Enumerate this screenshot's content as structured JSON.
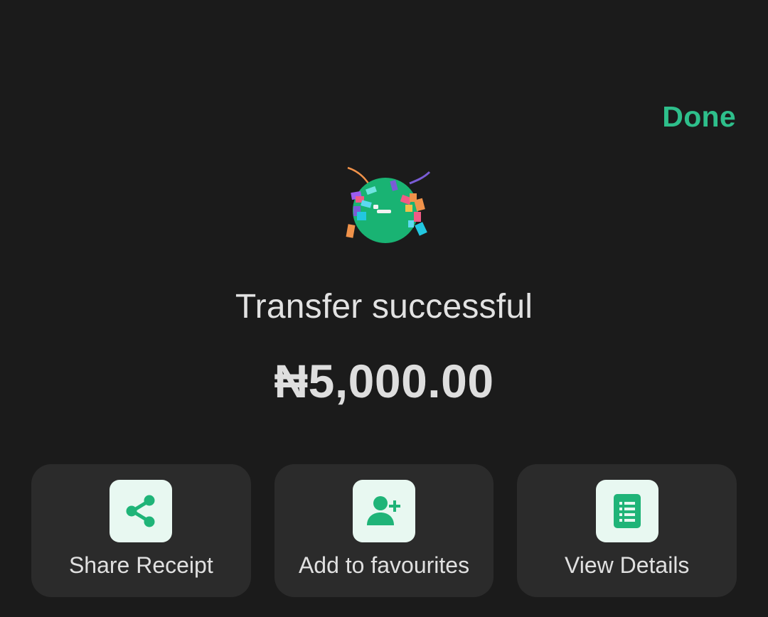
{
  "header": {
    "done_label": "Done"
  },
  "status": {
    "title": "Transfer successful",
    "amount": "₦5,000.00",
    "icon": "celebration-icon"
  },
  "actions": [
    {
      "label": "Share Receipt",
      "icon": "share-icon"
    },
    {
      "label": "Add to favourites",
      "icon": "add-user-icon"
    },
    {
      "label": "View Details",
      "icon": "document-list-icon"
    }
  ],
  "colors": {
    "background": "#1b1b1b",
    "accent": "#2ebf8b",
    "card": "#2b2b2b",
    "icon_tile": "#e8f8f1",
    "icon_green": "#1fb478"
  }
}
